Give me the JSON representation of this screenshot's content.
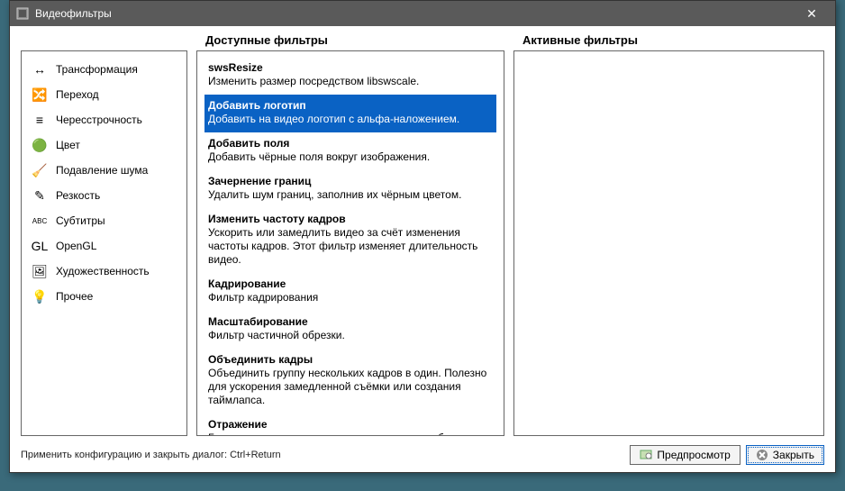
{
  "window": {
    "title": "Видеофильтры"
  },
  "headers": {
    "available": "Доступные фильтры",
    "active": "Активные фильтры"
  },
  "categories": [
    {
      "icon": "↔",
      "label": "Трансформация"
    },
    {
      "icon": "🔀",
      "label": "Переход"
    },
    {
      "icon": "≡",
      "label": "Чересстрочность"
    },
    {
      "icon": "🟢",
      "label": "Цвет"
    },
    {
      "icon": "🧹",
      "label": "Подавление шума"
    },
    {
      "icon": "✎",
      "label": "Резкость"
    },
    {
      "icon": "ABC",
      "label": "Субтитры"
    },
    {
      "icon": "GL",
      "label": "OpenGL"
    },
    {
      "icon": "🖼",
      "label": "Художественность"
    },
    {
      "icon": "💡",
      "label": "Прочее"
    }
  ],
  "available_filters": [
    {
      "name": "swsResize",
      "desc": "Изменить размер посредством libswscale.",
      "selected": false
    },
    {
      "name": "Добавить логотип",
      "desc": "Добавить на видео логотип с альфа-наложением.",
      "selected": true
    },
    {
      "name": "Добавить поля",
      "desc": "Добавить чёрные поля вокруг изображения.",
      "selected": false
    },
    {
      "name": "Зачернение границ",
      "desc": "Удалить шум границ, заполнив их чёрным цветом.",
      "selected": false
    },
    {
      "name": "Изменить частоту кадров",
      "desc": "Ускорить или замедлить видео за счёт изменения частоты кадров. Этот фильтр изменяет длительность видео.",
      "selected": false
    },
    {
      "name": "Кадрирование",
      "desc": "Фильтр кадрирования",
      "selected": false
    },
    {
      "name": "Масштабирование",
      "desc": "Фильтр частичной обрезки.",
      "selected": false
    },
    {
      "name": "Объединить кадры",
      "desc": "Объединить группу нескольких кадров в один. Полезно для ускорения замедленной съёмки или создания таймлапса.",
      "selected": false
    },
    {
      "name": "Отражение",
      "desc": "Горизонтально или вертикально отразить изображение.",
      "selected": false
    }
  ],
  "footer": {
    "hint": "Применить конфигурацию и закрыть диалог: Ctrl+Return",
    "preview": "Предпросмотр",
    "close": "Закрыть"
  }
}
